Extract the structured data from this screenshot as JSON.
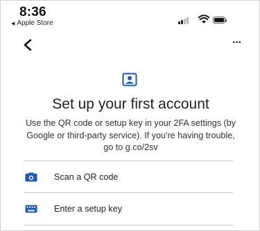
{
  "status_bar": {
    "time": "8:36",
    "back_app": "Apple Store"
  },
  "app_bar": {
    "back_icon": "chevron-left-icon",
    "more_icon": "more-horizontal-icon",
    "more_glyph": "···"
  },
  "hero": {
    "icon": "account-box-icon",
    "title": "Set up your first account",
    "description": "Use the QR code or setup key in your 2FA settings (by Google or third-party service). If you're having trouble, go to g.co/2sv"
  },
  "options": [
    {
      "icon": "camera-icon",
      "label": "Scan a QR code"
    },
    {
      "icon": "keyboard-icon",
      "label": "Enter a setup key"
    }
  ],
  "colors": {
    "accent": "#1a56c4",
    "text": "#202124",
    "divider": "#c8c8c8"
  }
}
